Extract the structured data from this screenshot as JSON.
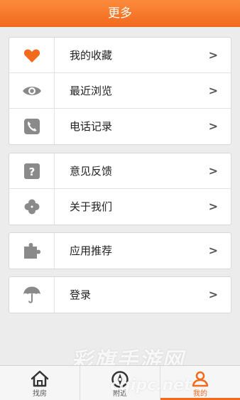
{
  "header": {
    "title": "更多"
  },
  "groups": [
    {
      "items": [
        {
          "label": "我的收藏",
          "icon": "heart-icon"
        },
        {
          "label": "最近浏览",
          "icon": "eye-icon"
        },
        {
          "label": "电话记录",
          "icon": "phone-icon"
        }
      ]
    },
    {
      "items": [
        {
          "label": "意见反馈",
          "icon": "question-icon"
        },
        {
          "label": "关于我们",
          "icon": "clover-icon"
        }
      ]
    },
    {
      "items": [
        {
          "label": "应用推荐",
          "icon": "puzzle-icon"
        }
      ]
    },
    {
      "items": [
        {
          "label": "登录",
          "icon": "umbrella-icon"
        }
      ]
    }
  ],
  "chevron": ">",
  "tabbar": {
    "tabs": [
      {
        "label": "找房",
        "icon": "house-icon"
      },
      {
        "label": "附近",
        "icon": "compass-icon"
      },
      {
        "label": "我的",
        "icon": "user-icon",
        "active": true
      }
    ]
  },
  "watermark": {
    "line1": "彩旗手游网",
    "line2": "cqipc.net"
  },
  "colors": {
    "accent": "#f26a1b",
    "icon_gray": "#8a8a8a",
    "background": "#ececec"
  }
}
